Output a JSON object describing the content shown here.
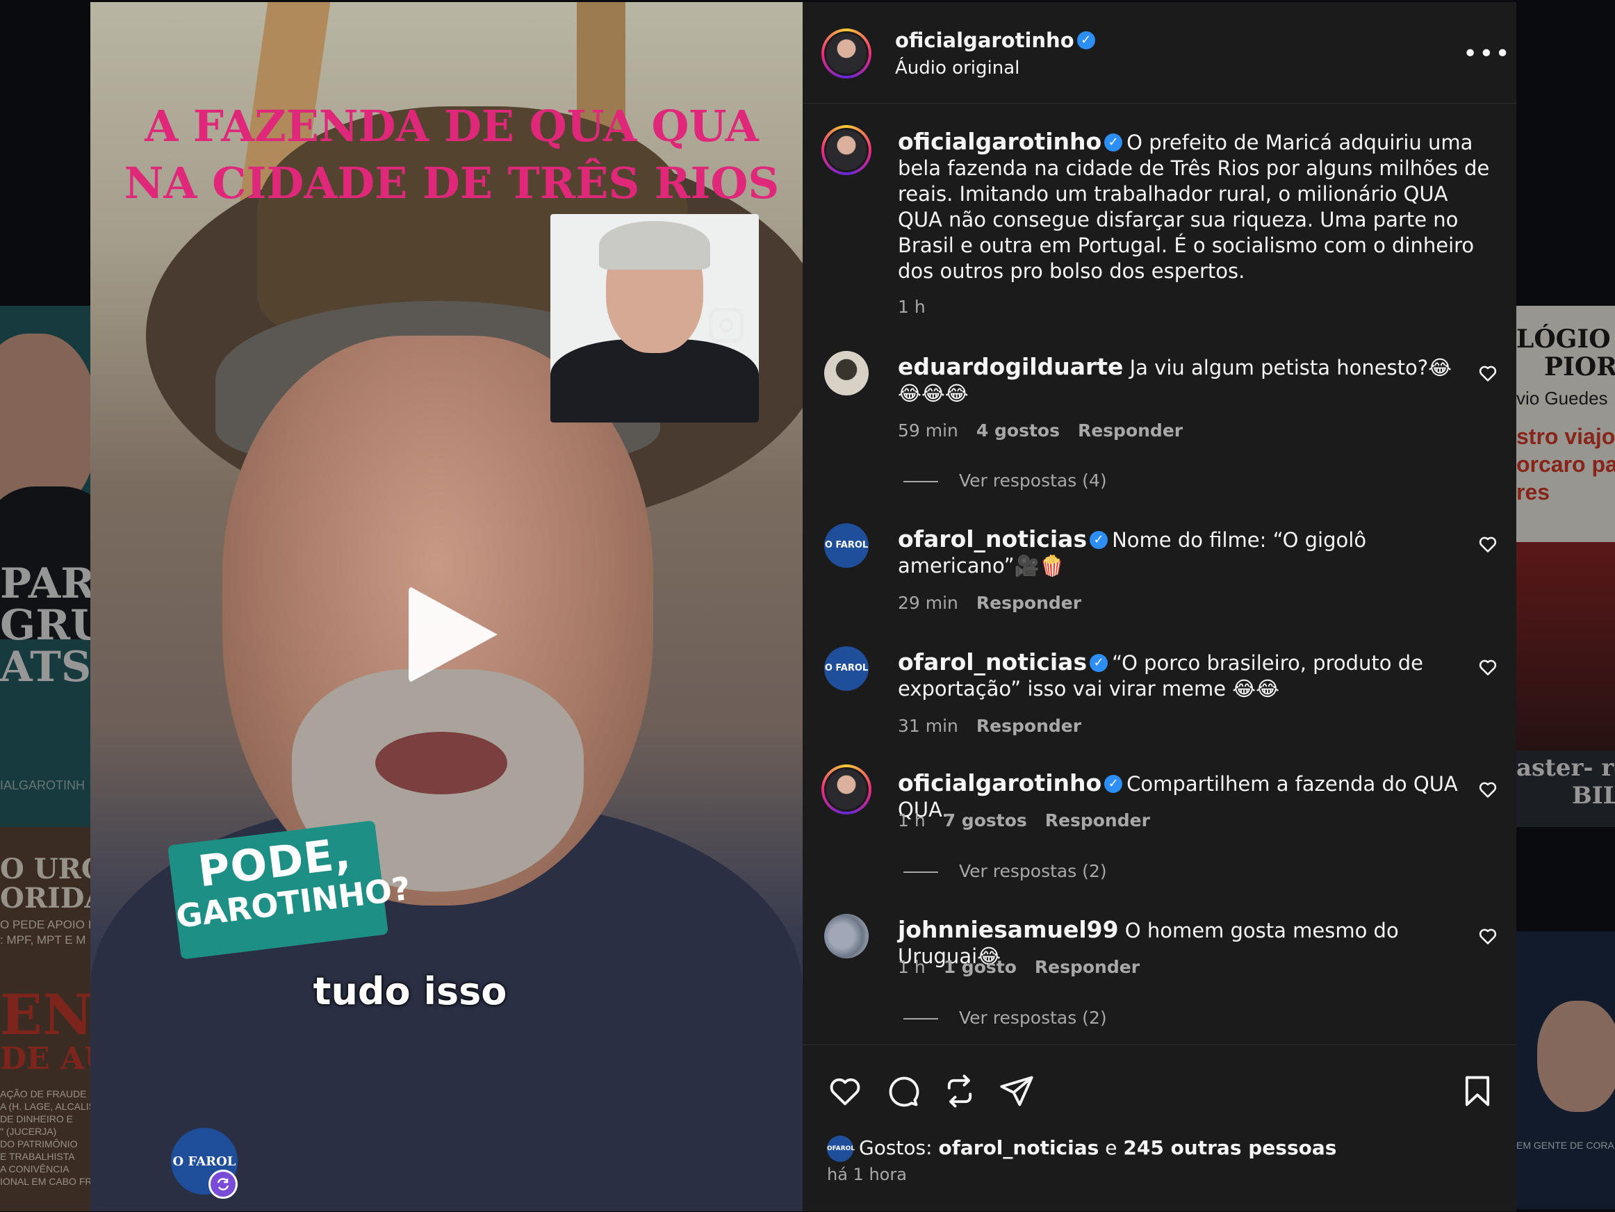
{
  "background": {
    "left_top_lines": [
      "PART",
      "GRUP",
      "ATSAI"
    ],
    "left_top_handle": "IALGAROTINH",
    "left_mid_lines": [
      "O URGE",
      "ORIDAD"
    ],
    "left_mid_small": [
      "O PEDE APOIO I",
      ": MPF, MPT E M"
    ],
    "left_bottom_big": [
      "ENTE",
      "DE AUXI"
    ],
    "left_bottom_small": [
      "AÇÃO DE FRAUDE",
      "A (H. LAGE, ALCALIS",
      "DE DINHEIRO E",
      "\" (JUCERJA)",
      "DO PATRIMÔNIO",
      "E TRABALHISTA",
      "A CONIVÊNCIA",
      "IONAL EM CABO FRIO"
    ],
    "right_top_lines": [
      "LÓGIO N/",
      "PIOR"
    ],
    "right_top_small": "vio Guedes",
    "right_top_red": [
      "stro viajo",
      "orcaro par",
      "res"
    ],
    "right_mid_lines": [
      "aster- ro",
      "BIL"
    ],
    "right_bottom_small": "EM GENTE DE CORA"
  },
  "video": {
    "title_overlay": "A FAZENDA DE QUA QUA NA CIDADE DE TRÊS RIOS",
    "badge_line1": "PODE,",
    "badge_line2": "GAROTINHO?",
    "caption": "tudo isso",
    "logo_text": "O FAROL",
    "play_icon": "play-icon",
    "remix_icon": "remix-icon"
  },
  "header": {
    "username": "oficialgarotinho",
    "subtitle": "Áudio original",
    "more_label": "•••"
  },
  "post": {
    "username": "oficialgarotinho",
    "caption": "O prefeito de Maricá adquiriu uma bela fazenda na cidade de Três Rios por alguns milhões de reais. Imitando um trabalhador rural, o milionário QUA QUA não consegue disfarçar sua riqueza. Uma parte no Brasil e outra em Portugal. É o socialismo com o dinheiro dos outros pro bolso dos espertos.",
    "time": "1 h"
  },
  "comments": [
    {
      "username": "eduardogilduarte",
      "verified": false,
      "text": "Ja viu algum petista honesto?😂😂😂😂",
      "time": "59 min",
      "likes": "4 gostos",
      "reply": "Responder",
      "view_replies": "Ver respostas (4)"
    },
    {
      "username": "ofarol_noticias",
      "verified": true,
      "text": "Nome do filme: “O gigolô americano”🎥🍿",
      "time": "29 min",
      "likes": "",
      "reply": "Responder",
      "view_replies": ""
    },
    {
      "username": "ofarol_noticias",
      "verified": true,
      "text": "“O porco brasileiro, produto de exportação” isso vai virar meme 😂😂",
      "time": "31 min",
      "likes": "",
      "reply": "Responder",
      "view_replies": ""
    },
    {
      "username": "oficialgarotinho",
      "verified": true,
      "text": "Compartilhem a fazenda do QUA QUA.",
      "time": "1 h",
      "likes": "7 gostos",
      "reply": "Responder",
      "view_replies": "Ver respostas (2)"
    },
    {
      "username": "johnniesamuel99",
      "verified": false,
      "text": "O homem gosta mesmo do Uruguai😂",
      "time": "1 h",
      "likes": "1 gosto",
      "reply": "Responder",
      "view_replies": "Ver respostas (2)"
    }
  ],
  "actions": {
    "likes_prefix": "Gostos:",
    "likes_user": "ofarol_noticias",
    "likes_conj": "e",
    "likes_rest": "245 outras pessoas",
    "time": "há 1 hora",
    "mini_logo": "OFAROL"
  },
  "colors": {
    "panel_bg": "#1b1b1c",
    "verified_blue": "#2d8ef5",
    "overlay_pink": "#e0287a",
    "badge_teal": "#1e8f84",
    "muted_text": "#a8a8a8"
  }
}
